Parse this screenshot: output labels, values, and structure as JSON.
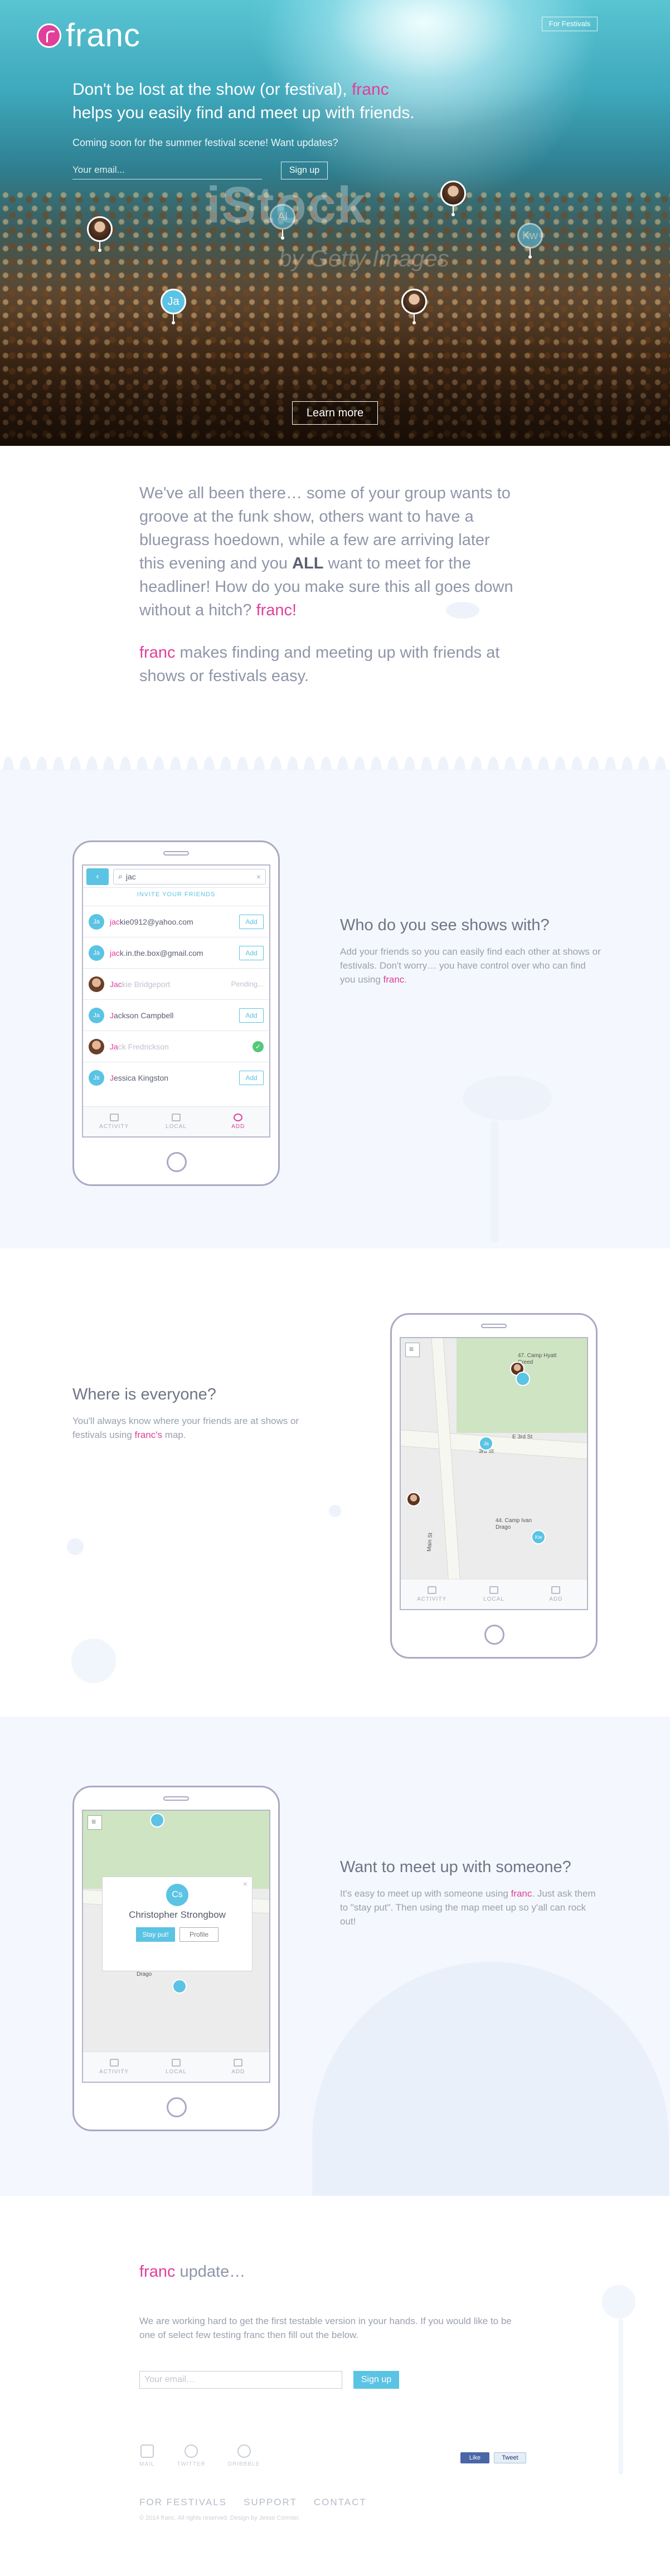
{
  "brand": {
    "name": "franc",
    "accent": "#e0409a",
    "blue": "#5bc3e3"
  },
  "header": {
    "festivals_button": "For Festivals"
  },
  "hero": {
    "headline_1": "Don't be lost at the show (or festival),",
    "headline_brand": "franc",
    "headline_2": "helps you easily find and meet up with friends.",
    "subline": "Coming soon for the summer festival scene! Want updates?",
    "email_placeholder": "Your email...",
    "signup_label": "Sign up",
    "watermark": "iStock",
    "watermark_sub": "by Getty Images",
    "learn_more": "Learn more",
    "pins": [
      "Al",
      "Kw",
      "Ja"
    ]
  },
  "intro": {
    "p1_a": "We've all been there… some of your group wants to groove at the funk show, others want to have a bluegrass hoedown, while a few are arriving later this evening and you",
    "p1_bold": "ALL",
    "p1_b": "want to meet for the headliner! How do you make sure this all goes down without a hitch?",
    "p1_brand": "franc!",
    "p2_brand": "franc",
    "p2": "makes finding and meeting up with friends at shows or festivals easy."
  },
  "feature1": {
    "title": "Who do you see shows with?",
    "text_a": "Add your friends so you can easily find each other at shows or festivals. Don't worry… you have control over who can find you using",
    "text_brand": "franc",
    "text_end": ".",
    "search_value": "jac",
    "invite_label": "INVITE YOUR FRIENDS",
    "contacts": [
      {
        "initials": "Ja",
        "hl": "jac",
        "rest": "kie0912@yahoo.com",
        "action": "Add"
      },
      {
        "initials": "Ja",
        "hl": "jac",
        "rest": "k.in.the.box@gmail.com",
        "action": "Add"
      },
      {
        "initials": "",
        "hl": "Jac",
        "rest": "kie Bridgeport",
        "action": "Pending..."
      },
      {
        "initials": "Ja",
        "hl": "J",
        "rest": "ackson Campbell",
        "action": "Add"
      },
      {
        "initials": "",
        "hl": "Ja",
        "rest": "ck Fredrickson",
        "action": "✓"
      },
      {
        "initials": "Js",
        "hl": "J",
        "rest": "essica Kingston",
        "action": "Add"
      }
    ],
    "tabs": [
      "ACTIVITY",
      "LOCAL",
      "ADD"
    ]
  },
  "feature2": {
    "title": "Where is everyone?",
    "text_a": "You'll always know where your friends are at shows or festivals using",
    "text_brand": "franc's",
    "text_end": "map.",
    "map_labels": [
      "47. Camp Hyatt Creed",
      "E 3rd St",
      "3rd St",
      "44. Camp Ivan Drago",
      "Main St"
    ],
    "pins": [
      "Ja",
      "Kw"
    ],
    "tabs": [
      "ACTIVITY",
      "LOCAL",
      "ADD"
    ]
  },
  "feature3": {
    "title": "Want to meet up with someone?",
    "text_a": "It's easy to meet up with someone using",
    "text_brand": "franc",
    "text_b": ". Just ask them to \"stay put\". Then using the map meet up so y'all can rock out!",
    "popup_initials": "Cs",
    "popup_name": "Christopher Strongbow",
    "stay_put": "Stay put!",
    "profile": "Profile",
    "map_label": "44. Camp Ivan Drago",
    "tabs": [
      "ACTIVITY",
      "LOCAL",
      "ADD"
    ]
  },
  "update": {
    "title_brand": "franc",
    "title_rest": "update…",
    "text": "We are working hard to get the first testable version in your hands. If you would like to be one of select few testing franc then fill out the below.",
    "email_placeholder": "Your email…",
    "signup_label": "Sign up"
  },
  "social": {
    "items": [
      "MAIL",
      "TWITTER",
      "DRIBBBLE"
    ],
    "fb": "Like",
    "tweet": "Tweet"
  },
  "footer": {
    "links": [
      "FOR FESTIVALS",
      "SUPPORT",
      "CONTACT"
    ],
    "copyright": "© 2014 franc. All rights reserved. Design by Jesse Cormier."
  }
}
